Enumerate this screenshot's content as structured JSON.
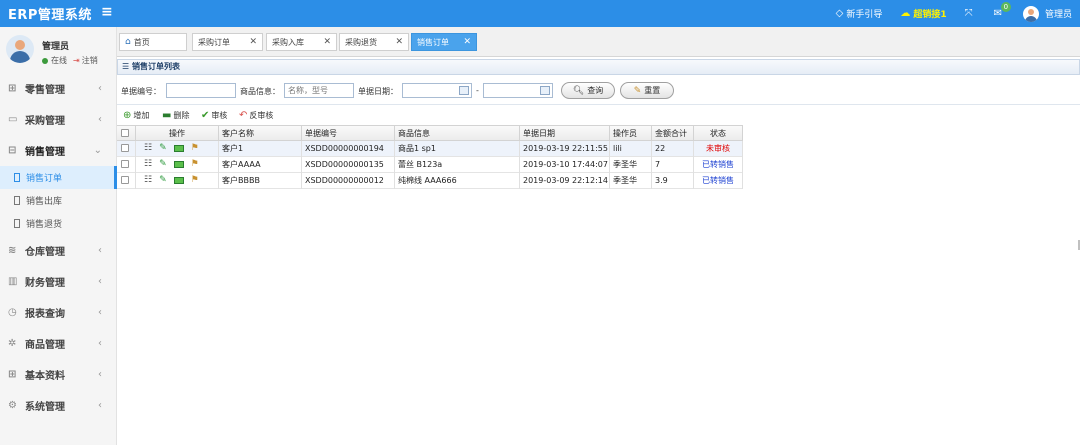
{
  "topbar": {
    "brand": "ERP管理系统",
    "menu_toggle": "≡",
    "guide": "新手引导",
    "promo": "超销接1",
    "fullscreen": "⤧",
    "messages_badge": "0",
    "user": "管理员"
  },
  "sidebar": {
    "user_name": "管理员",
    "status": "在线",
    "logout": "注销",
    "menus": [
      {
        "label": "零售管理",
        "icon": "gift-icon"
      },
      {
        "label": "采购管理",
        "icon": "monitor-icon"
      },
      {
        "label": "销售管理",
        "icon": "briefcase-icon"
      },
      {
        "label": "仓库管理",
        "icon": "layers-icon"
      },
      {
        "label": "财务管理",
        "icon": "map-icon"
      },
      {
        "label": "报表查询",
        "icon": "clock-icon"
      },
      {
        "label": "商品管理",
        "icon": "gear-icon"
      },
      {
        "label": "基本资料",
        "icon": "grid-icon"
      },
      {
        "label": "系统管理",
        "icon": "settings-icon"
      }
    ],
    "submenus": [
      "销售订单",
      "销售出库",
      "销售退货"
    ]
  },
  "tabs": [
    {
      "label": "首页"
    },
    {
      "label": "采购订单"
    },
    {
      "label": "采购入库"
    },
    {
      "label": "采购退货"
    },
    {
      "label": "销售订单"
    }
  ],
  "panel": {
    "title": "销售订单列表"
  },
  "search": {
    "doc_no_label": "单据编号：",
    "goods_label": "商品信息：",
    "goods_placeholder": "名称，型号",
    "date_label": "单据日期：",
    "date_sep": "-",
    "query_button": "查询",
    "reset_button": "重置"
  },
  "toolbar": {
    "add": "增加",
    "delete": "删除",
    "audit": "审核",
    "unaudit": "反审核"
  },
  "grid": {
    "headers": [
      "操作",
      "客户名称",
      "单据编号",
      "商品信息",
      "单据日期",
      "操作员",
      "金额合计",
      "状态"
    ],
    "rows": [
      {
        "customer": "客户1",
        "doc_no": "XSDD00000000194",
        "goods": "商品1 sp1",
        "date": "2019-03-19 22:11:55",
        "operator": "lili",
        "amount": "22",
        "status": "未审核"
      },
      {
        "customer": "客户AAAA",
        "doc_no": "XSDD00000000135",
        "goods": "蕾丝 B123a",
        "date": "2019-03-10 17:44:07",
        "operator": "季圣华",
        "amount": "7",
        "status": "已转销售"
      },
      {
        "customer": "客户BBBB",
        "doc_no": "XSDD00000000012",
        "goods": "纯棉线 AAA666",
        "date": "2019-03-09 22:12:14",
        "operator": "季圣华",
        "amount": "3.9",
        "status": "已转销售"
      }
    ]
  },
  "colors": {
    "topbar": "#2c8ee7",
    "active_tab": "#4aa3ec",
    "status_unaudited": "#e00000",
    "status_converted": "#1b3fd1"
  }
}
